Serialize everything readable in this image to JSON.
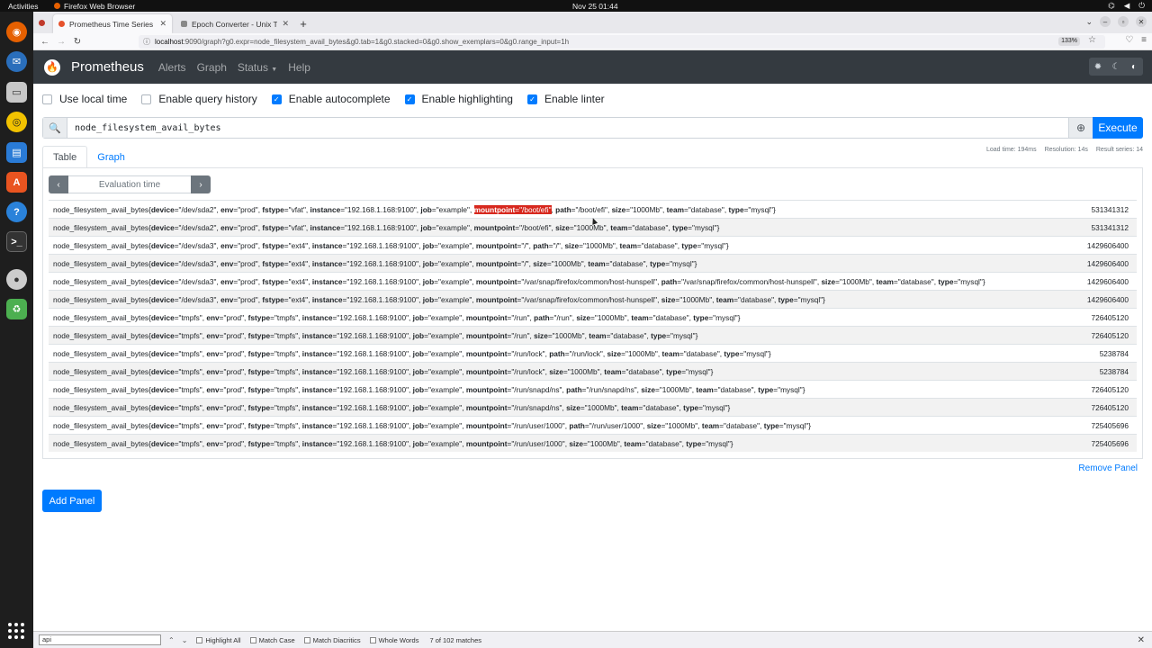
{
  "desktop": {
    "activities": "Activities",
    "app_name": "Firefox Web Browser",
    "clock": "Nov 25  01:44"
  },
  "browser": {
    "tabs": [
      {
        "title": "Prometheus Time Series",
        "active": true
      },
      {
        "title": "Epoch Converter - Unix Ti",
        "active": false
      }
    ],
    "url_host": "localhost",
    "url_rest": ":9090/graph?g0.expr=node_filesystem_avail_bytes&g0.tab=1&g0.stacked=0&g0.show_exemplars=0&g0.range_input=1h",
    "zoom": "133%"
  },
  "prometheus": {
    "brand": "Prometheus",
    "nav": [
      "Alerts",
      "Graph",
      "Status",
      "Help"
    ],
    "options": [
      {
        "label": "Use local time",
        "checked": false
      },
      {
        "label": "Enable query history",
        "checked": false
      },
      {
        "label": "Enable autocomplete",
        "checked": true
      },
      {
        "label": "Enable highlighting",
        "checked": true
      },
      {
        "label": "Enable linter",
        "checked": true
      }
    ],
    "query": "node_filesystem_avail_bytes",
    "execute": "Execute",
    "stats": {
      "load_time": "Load time: 194ms",
      "resolution": "Resolution: 14s",
      "result_series": "Result series: 14"
    },
    "panel_tabs": [
      "Table",
      "Graph"
    ],
    "eval_time_placeholder": "Evaluation time",
    "remove_panel": "Remove Panel",
    "add_panel": "Add Panel",
    "metric": "node_filesystem_avail_bytes",
    "rows": [
      {
        "labels": [
          [
            "device",
            "/dev/sda2"
          ],
          [
            "env",
            "prod"
          ],
          [
            "fstype",
            "vfat"
          ],
          [
            "instance",
            "192.168.1.168:9100"
          ],
          [
            "job",
            "example"
          ],
          [
            "mountpoint",
            "/boot/efi"
          ],
          [
            "path",
            "/boot/efi"
          ],
          [
            "size",
            "1000Mb"
          ],
          [
            "team",
            "database"
          ],
          [
            "type",
            "mysql"
          ]
        ],
        "value": "531341312",
        "highlight": "mountpoint"
      },
      {
        "labels": [
          [
            "device",
            "/dev/sda2"
          ],
          [
            "env",
            "prod"
          ],
          [
            "fstype",
            "vfat"
          ],
          [
            "instance",
            "192.168.1.168:9100"
          ],
          [
            "job",
            "example"
          ],
          [
            "mountpoint",
            "/boot/efi"
          ],
          [
            "size",
            "1000Mb"
          ],
          [
            "team",
            "database"
          ],
          [
            "type",
            "mysql"
          ]
        ],
        "value": "531341312"
      },
      {
        "labels": [
          [
            "device",
            "/dev/sda3"
          ],
          [
            "env",
            "prod"
          ],
          [
            "fstype",
            "ext4"
          ],
          [
            "instance",
            "192.168.1.168:9100"
          ],
          [
            "job",
            "example"
          ],
          [
            "mountpoint",
            "/"
          ],
          [
            "path",
            "/"
          ],
          [
            "size",
            "1000Mb"
          ],
          [
            "team",
            "database"
          ],
          [
            "type",
            "mysql"
          ]
        ],
        "value": "1429606400"
      },
      {
        "labels": [
          [
            "device",
            "/dev/sda3"
          ],
          [
            "env",
            "prod"
          ],
          [
            "fstype",
            "ext4"
          ],
          [
            "instance",
            "192.168.1.168:9100"
          ],
          [
            "job",
            "example"
          ],
          [
            "mountpoint",
            "/"
          ],
          [
            "size",
            "1000Mb"
          ],
          [
            "team",
            "database"
          ],
          [
            "type",
            "mysql"
          ]
        ],
        "value": "1429606400"
      },
      {
        "labels": [
          [
            "device",
            "/dev/sda3"
          ],
          [
            "env",
            "prod"
          ],
          [
            "fstype",
            "ext4"
          ],
          [
            "instance",
            "192.168.1.168:9100"
          ],
          [
            "job",
            "example"
          ],
          [
            "mountpoint",
            "/var/snap/firefox/common/host-hunspell"
          ],
          [
            "path",
            "/var/snap/firefox/common/host-hunspell"
          ],
          [
            "size",
            "1000Mb"
          ],
          [
            "team",
            "database"
          ],
          [
            "type",
            "mysql"
          ]
        ],
        "value": "1429606400"
      },
      {
        "labels": [
          [
            "device",
            "/dev/sda3"
          ],
          [
            "env",
            "prod"
          ],
          [
            "fstype",
            "ext4"
          ],
          [
            "instance",
            "192.168.1.168:9100"
          ],
          [
            "job",
            "example"
          ],
          [
            "mountpoint",
            "/var/snap/firefox/common/host-hunspell"
          ],
          [
            "size",
            "1000Mb"
          ],
          [
            "team",
            "database"
          ],
          [
            "type",
            "mysql"
          ]
        ],
        "value": "1429606400"
      },
      {
        "labels": [
          [
            "device",
            "tmpfs"
          ],
          [
            "env",
            "prod"
          ],
          [
            "fstype",
            "tmpfs"
          ],
          [
            "instance",
            "192.168.1.168:9100"
          ],
          [
            "job",
            "example"
          ],
          [
            "mountpoint",
            "/run"
          ],
          [
            "path",
            "/run"
          ],
          [
            "size",
            "1000Mb"
          ],
          [
            "team",
            "database"
          ],
          [
            "type",
            "mysql"
          ]
        ],
        "value": "726405120"
      },
      {
        "labels": [
          [
            "device",
            "tmpfs"
          ],
          [
            "env",
            "prod"
          ],
          [
            "fstype",
            "tmpfs"
          ],
          [
            "instance",
            "192.168.1.168:9100"
          ],
          [
            "job",
            "example"
          ],
          [
            "mountpoint",
            "/run"
          ],
          [
            "size",
            "1000Mb"
          ],
          [
            "team",
            "database"
          ],
          [
            "type",
            "mysql"
          ]
        ],
        "value": "726405120"
      },
      {
        "labels": [
          [
            "device",
            "tmpfs"
          ],
          [
            "env",
            "prod"
          ],
          [
            "fstype",
            "tmpfs"
          ],
          [
            "instance",
            "192.168.1.168:9100"
          ],
          [
            "job",
            "example"
          ],
          [
            "mountpoint",
            "/run/lock"
          ],
          [
            "path",
            "/run/lock"
          ],
          [
            "size",
            "1000Mb"
          ],
          [
            "team",
            "database"
          ],
          [
            "type",
            "mysql"
          ]
        ],
        "value": "5238784"
      },
      {
        "labels": [
          [
            "device",
            "tmpfs"
          ],
          [
            "env",
            "prod"
          ],
          [
            "fstype",
            "tmpfs"
          ],
          [
            "instance",
            "192.168.1.168:9100"
          ],
          [
            "job",
            "example"
          ],
          [
            "mountpoint",
            "/run/lock"
          ],
          [
            "size",
            "1000Mb"
          ],
          [
            "team",
            "database"
          ],
          [
            "type",
            "mysql"
          ]
        ],
        "value": "5238784"
      },
      {
        "labels": [
          [
            "device",
            "tmpfs"
          ],
          [
            "env",
            "prod"
          ],
          [
            "fstype",
            "tmpfs"
          ],
          [
            "instance",
            "192.168.1.168:9100"
          ],
          [
            "job",
            "example"
          ],
          [
            "mountpoint",
            "/run/snapd/ns"
          ],
          [
            "path",
            "/run/snapd/ns"
          ],
          [
            "size",
            "1000Mb"
          ],
          [
            "team",
            "database"
          ],
          [
            "type",
            "mysql"
          ]
        ],
        "value": "726405120"
      },
      {
        "labels": [
          [
            "device",
            "tmpfs"
          ],
          [
            "env",
            "prod"
          ],
          [
            "fstype",
            "tmpfs"
          ],
          [
            "instance",
            "192.168.1.168:9100"
          ],
          [
            "job",
            "example"
          ],
          [
            "mountpoint",
            "/run/snapd/ns"
          ],
          [
            "size",
            "1000Mb"
          ],
          [
            "team",
            "database"
          ],
          [
            "type",
            "mysql"
          ]
        ],
        "value": "726405120"
      },
      {
        "labels": [
          [
            "device",
            "tmpfs"
          ],
          [
            "env",
            "prod"
          ],
          [
            "fstype",
            "tmpfs"
          ],
          [
            "instance",
            "192.168.1.168:9100"
          ],
          [
            "job",
            "example"
          ],
          [
            "mountpoint",
            "/run/user/1000"
          ],
          [
            "path",
            "/run/user/1000"
          ],
          [
            "size",
            "1000Mb"
          ],
          [
            "team",
            "database"
          ],
          [
            "type",
            "mysql"
          ]
        ],
        "value": "725405696"
      },
      {
        "labels": [
          [
            "device",
            "tmpfs"
          ],
          [
            "env",
            "prod"
          ],
          [
            "fstype",
            "tmpfs"
          ],
          [
            "instance",
            "192.168.1.168:9100"
          ],
          [
            "job",
            "example"
          ],
          [
            "mountpoint",
            "/run/user/1000"
          ],
          [
            "size",
            "1000Mb"
          ],
          [
            "team",
            "database"
          ],
          [
            "type",
            "mysql"
          ]
        ],
        "value": "725405696"
      }
    ]
  },
  "findbar": {
    "query": "api",
    "highlight_all": "Highlight All",
    "match_case": "Match Case",
    "match_diacritics": "Match Diacritics",
    "whole_words": "Whole Words",
    "count": "7 of 102 matches"
  },
  "colors": {
    "navbar": "#343a40",
    "primary": "#007bff",
    "highlight": "#d7281e"
  }
}
